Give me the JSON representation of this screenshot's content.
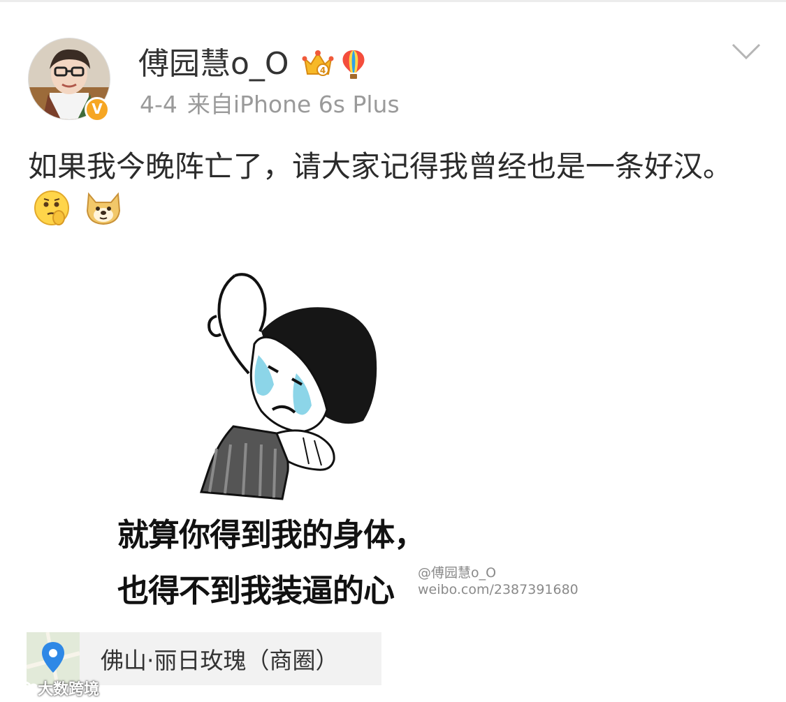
{
  "post": {
    "username": "傅园慧o_O",
    "date": "4-4",
    "source": "来自iPhone 6s Plus",
    "text": "如果我今晚阵亡了，请大家记得我曾经也是一条好汉。",
    "icons": {
      "avatar": "user-avatar",
      "verified": "verified-badge-icon",
      "crown": "crown-level-icon",
      "balloon": "hot-air-balloon-icon",
      "chevron": "chevron-down-icon",
      "emoji1": "thinking-face-emoji",
      "emoji2": "doge-emoji"
    },
    "verified_mark": "V",
    "crown_level": "4"
  },
  "meme": {
    "caption_line1": "就算你得到我的身体，",
    "caption_line2": "也得不到我装逼的心",
    "watermark_name": "@傅园慧o_O",
    "watermark_url": "weibo.com/2387391680"
  },
  "location": {
    "label": "佛山·丽日玫瑰（商圈）",
    "icon": "location-pin-icon"
  },
  "corner_logo": {
    "text": "大数跨境",
    "icon": "brand-logo-icon"
  },
  "colors": {
    "accent": "#f6a623",
    "meta_gray": "#9a9a9a",
    "location_bg": "#f2f2f2",
    "pin_blue": "#2e88e6"
  }
}
